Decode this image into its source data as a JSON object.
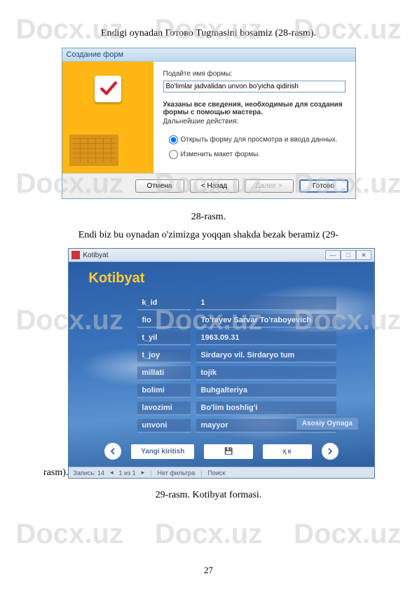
{
  "watermark": "Docx.uz",
  "caption1": "Endigi oynadan Готово Tugmasini bosamiz (28-rasm).",
  "caption2": "28-rasm.",
  "caption3": "Endi biz bu oynadan o'zimizga yoqqan shakda bezak beramiz (29-",
  "caption3b": "rasm).",
  "caption4": "29-rasm. Kotibyat formasi.",
  "pageNumber": "27",
  "dialog1": {
    "title": "Создание форм",
    "nameLabel": "Подайте имя формы:",
    "nameValue": "Bo'limlar jadvalidan unvon bo'yicha qidirish",
    "infoBold": "Указаны все сведения, необходимые для создания формы с помощью мастера.",
    "nextLabel": "Дальнейшие действия:",
    "radio1": "Открыть форму для просмотра и ввода данных.",
    "radio2": "Изменить макет формы.",
    "btnCancel": "Отмена",
    "btnBack": "< Назад",
    "btnNext": "Далее >",
    "btnFinish": "Готово"
  },
  "win2": {
    "title": "Kotibyat",
    "formTitle": "Kotibyat",
    "fields": [
      {
        "label": "k_id",
        "value": "1"
      },
      {
        "label": "fio",
        "value": "To'rayev Sarvar To'raboyevich"
      },
      {
        "label": "t_yil",
        "value": "1963.09.31"
      },
      {
        "label": "t_joy",
        "value": "Sirdaryo vil. Sirdaryo tum"
      },
      {
        "label": "millati",
        "value": "tojik"
      },
      {
        "label": "bolimi",
        "value": "Buhgalteriya"
      },
      {
        "label": "lavozimi",
        "value": "Bo'lim boshlig'i"
      },
      {
        "label": "unvoni",
        "value": "mayyor"
      }
    ],
    "asosiy": "Asosiy Oynaga",
    "btnNew": "Yangi kiritish",
    "btnSaveIcon": "💾",
    "btnNK": "ҳк",
    "statusRecord": "Запись: 14",
    "statusPos": "1 из 1",
    "statusFilter": "Нет фильтра",
    "statusSearch": "Поиск"
  }
}
